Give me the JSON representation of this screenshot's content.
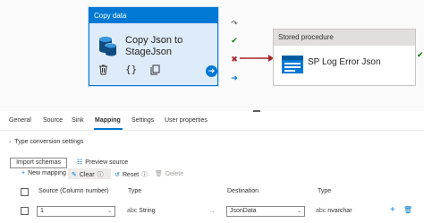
{
  "pipeline": {
    "copy_activity": {
      "header": "Copy data",
      "title": "Copy Json to StageJson"
    },
    "sp_activity": {
      "header": "Stored procedure",
      "title": "SP Log Error Json"
    }
  },
  "tabs": [
    {
      "label": "General"
    },
    {
      "label": "Source"
    },
    {
      "label": "Sink"
    },
    {
      "label": "Mapping",
      "active": true
    },
    {
      "label": "Settings"
    },
    {
      "label": "User properties"
    }
  ],
  "mapping": {
    "type_conversion": "Type conversion settings",
    "import_schemas": "Import schemas",
    "preview_source": "Preview source",
    "toolbar": {
      "new_mapping": "New mapping",
      "clear": "Clear",
      "reset": "Reset",
      "delete": "Delete"
    },
    "columns": {
      "source": "Source (Column number)",
      "type": "Type",
      "destination": "Destination",
      "dest_type": "Type"
    },
    "rows": [
      {
        "source": "1",
        "type": "String",
        "destination": "JsonData",
        "dest_type": "nvarchar"
      }
    ]
  },
  "colors": {
    "accent": "#0078d4",
    "success": "#107c10",
    "failure": "#a4262c"
  }
}
